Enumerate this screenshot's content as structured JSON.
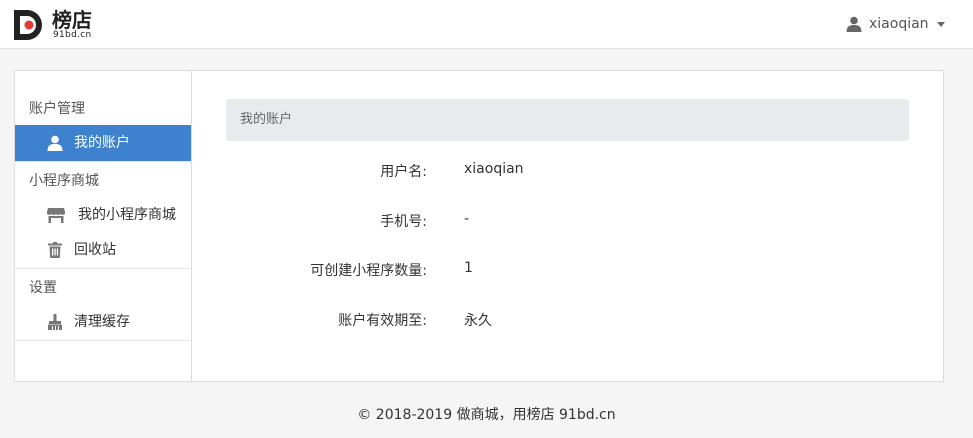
{
  "header": {
    "logo_name": "榜店",
    "logo_domain": "91bd.cn",
    "username": "xiaoqian"
  },
  "sidebar": {
    "groups": [
      {
        "title": "账户管理",
        "items": [
          {
            "label": "我的账户",
            "icon": "user-icon",
            "active": true
          }
        ]
      },
      {
        "title": "小程序商城",
        "items": [
          {
            "label": "我的小程序商城",
            "icon": "store-icon",
            "active": false
          },
          {
            "label": "回收站",
            "icon": "trash-icon",
            "active": false
          }
        ]
      },
      {
        "title": "设置",
        "items": [
          {
            "label": "清理缓存",
            "icon": "broom-icon",
            "active": false
          }
        ]
      }
    ]
  },
  "main": {
    "title": "我的账户",
    "fields": [
      {
        "label": "用户名:",
        "value": "xiaoqian"
      },
      {
        "label": "手机号:",
        "value": "-"
      },
      {
        "label": "可创建小程序数量:",
        "value": "1"
      },
      {
        "label": "账户有效期至:",
        "value": "永久"
      }
    ]
  },
  "footer": {
    "text": "© 2018-2019 做商城，用榜店 91bd.cn"
  },
  "colors": {
    "accent": "#3e82cf",
    "title_bar": "#e8eaed"
  }
}
